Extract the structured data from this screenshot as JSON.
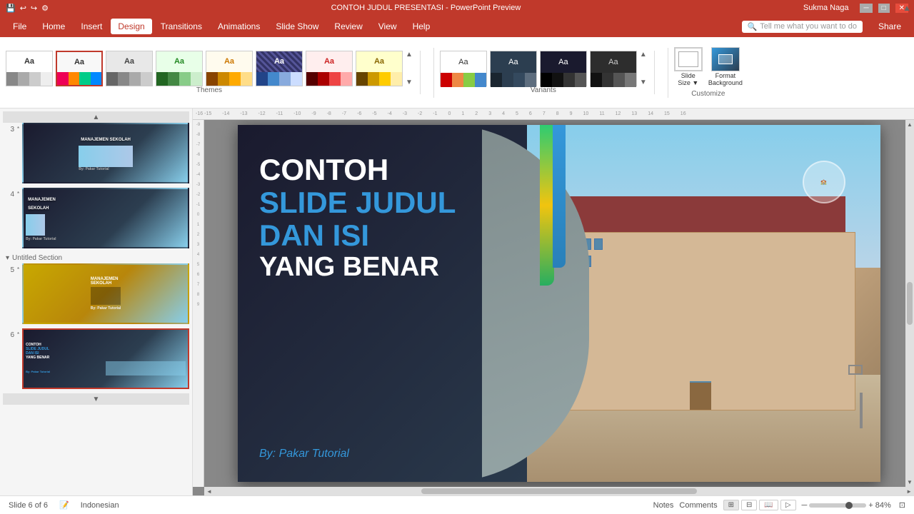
{
  "titlebar": {
    "title": "CONTOH JUDUL PRESENTASI - PowerPoint Preview",
    "user": "Sukma Naga",
    "minimize": "─",
    "maximize": "□",
    "close": "✕"
  },
  "menubar": {
    "items": [
      "File",
      "Home",
      "Insert",
      "Design",
      "Transitions",
      "Animations",
      "Slide Show",
      "Review",
      "View",
      "Help"
    ],
    "active": "Design",
    "search_placeholder": "Tell me what you want to do",
    "share": "Share"
  },
  "ribbon": {
    "themes_label": "Themes",
    "variants_label": "Variants",
    "customize_label": "Customize",
    "slide_size": "Slide\nSize",
    "format_bg": "Format\nBackground"
  },
  "slides": [
    {
      "num": "3",
      "star": "*",
      "active": false,
      "title": "MANAJEMEN SEKOLAH",
      "theme": "dark-blue"
    },
    {
      "num": "4",
      "star": "*",
      "active": false,
      "title": "MANAJEMEN SEKOLAH",
      "theme": "dark-blue"
    },
    {
      "num": "5",
      "star": "*",
      "active": false,
      "title": "MANAJEMEN SEKOLAH",
      "theme": "yellow"
    },
    {
      "num": "6",
      "star": "*",
      "active": true,
      "title": "CONTOH SLIDE JUDUL DAN ISI YANG BENAR",
      "theme": "dark-blue-current"
    }
  ],
  "section": "Untitled Section",
  "slide_content": {
    "line1": "CONTOH",
    "line2": "SLIDE JUDUL",
    "line3": "DAN ISI",
    "line4": "YANG BENAR",
    "author": "By: Pakar Tutorial"
  },
  "statusbar": {
    "slide_info": "Slide 6 of 6",
    "language": "Indonesian",
    "notes": "Notes",
    "comments": "Comments",
    "zoom": "84%"
  },
  "themes": [
    {
      "label": "Aa",
      "colors": [
        "#fff",
        "#ddd",
        "#888",
        "#555"
      ]
    },
    {
      "label": "Aa",
      "colors": [
        "#e8e8ff",
        "#aaaaff",
        "#5555cc",
        "#222288"
      ]
    },
    {
      "label": "Aa",
      "colors": [
        "#fff",
        "#e0e0e0",
        "#888",
        "#444"
      ]
    },
    {
      "label": "Aa",
      "colors": [
        "#e8ffe8",
        "#88cc88",
        "#338833",
        "#115511"
      ]
    },
    {
      "label": "Aa",
      "colors": [
        "#fff8e8",
        "#ffcc88",
        "#cc8833",
        "#884411"
      ]
    },
    {
      "label": "Aa",
      "colors": [
        "#2255aa",
        "#4488dd",
        "#88aacc",
        "#ccddee"
      ]
    },
    {
      "label": "Aa",
      "colors": [
        "#440000",
        "#cc2222",
        "#ff8888",
        "#ffcccc"
      ]
    },
    {
      "label": "Aa",
      "colors": [
        "#ffee00",
        "#ffaa00",
        "#cc6600",
        "#884400"
      ]
    }
  ],
  "variants": [
    {
      "type": "light"
    },
    {
      "type": "dark1"
    },
    {
      "type": "dark2"
    },
    {
      "type": "dark3"
    }
  ]
}
